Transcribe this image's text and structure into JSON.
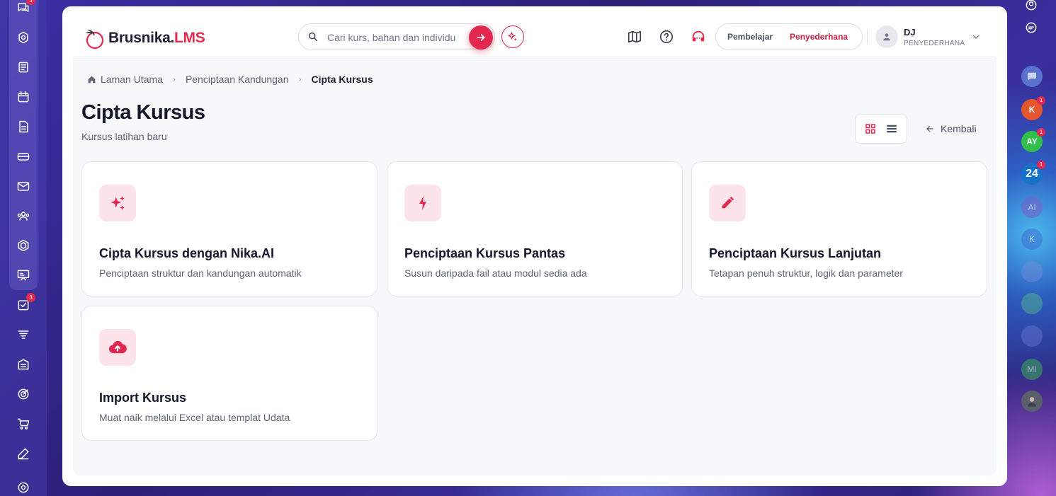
{
  "left_rail": {
    "items": [
      {
        "icon": "chat-bubbles-icon",
        "badge": "3"
      },
      {
        "icon": "badge-cog-icon",
        "badge": ""
      },
      {
        "icon": "news-icon",
        "badge": ""
      },
      {
        "icon": "calendar-icon",
        "badge": ""
      },
      {
        "icon": "document-icon",
        "badge": ""
      },
      {
        "icon": "card-icon",
        "badge": ""
      },
      {
        "icon": "mail-icon",
        "badge": ""
      },
      {
        "icon": "users-icon",
        "badge": ""
      },
      {
        "icon": "hexagon-icon",
        "badge": ""
      },
      {
        "icon": "presentation-icon",
        "badge": ""
      },
      {
        "icon": "checklist-icon",
        "badge": "3"
      },
      {
        "icon": "filter-stack-icon",
        "badge": ""
      },
      {
        "icon": "building-icon",
        "badge": ""
      },
      {
        "icon": "target-icon",
        "badge": ""
      },
      {
        "icon": "cart-icon",
        "badge": ""
      },
      {
        "icon": "pen-icon",
        "badge": ""
      },
      {
        "icon": "settings-icon",
        "badge": ""
      }
    ]
  },
  "right_rail": {
    "avatars": [
      {
        "initials": "K",
        "color": "#e4572e",
        "badge": "1"
      },
      {
        "initials": "AY",
        "color": "#2fbf4a",
        "badge": "1"
      },
      {
        "initials": "24",
        "color": "#1672c9",
        "badge": "1"
      },
      {
        "initials": "AI",
        "color": "#7a5fc7",
        "badge": ""
      },
      {
        "initials": "K",
        "color": "#3f6fd1",
        "badge": ""
      },
      {
        "initials": "MI",
        "color": "#3aa35a",
        "badge": ""
      }
    ]
  },
  "header": {
    "logo_text": "Brusnika.",
    "logo_accent": "LMS",
    "search_placeholder": "Cari kurs, bahan dan individu",
    "role_learner": "Pembelajar",
    "role_simplifier": "Penyederhana",
    "user_initials": "DJ",
    "user_role": "PENYEDERHANA",
    "accent_color": "#e3284f"
  },
  "breadcrumb": {
    "home": "Laman Utama",
    "parent": "Penciptaan Kandungan",
    "current": "Cipta Kursus"
  },
  "page": {
    "title": "Cipta Kursus",
    "subtitle": "Kursus latihan baru",
    "back_label": "Kembali"
  },
  "options": [
    {
      "icon": "sparkles-icon",
      "title": "Cipta Kursus dengan Nika.AI",
      "desc": "Penciptaan struktur dan kandungan automatik"
    },
    {
      "icon": "lightning-icon",
      "title": "Penciptaan Kursus Pantas",
      "desc": "Susun daripada fail atau modul sedia ada"
    },
    {
      "icon": "pencil-icon",
      "title": "Penciptaan Kursus Lanjutan",
      "desc": "Tetapan penuh struktur, logik dan parameter"
    },
    {
      "icon": "cloud-upload-icon",
      "title": "Import Kursus",
      "desc": "Muat naik melalui Excel atau templat Udata"
    }
  ]
}
